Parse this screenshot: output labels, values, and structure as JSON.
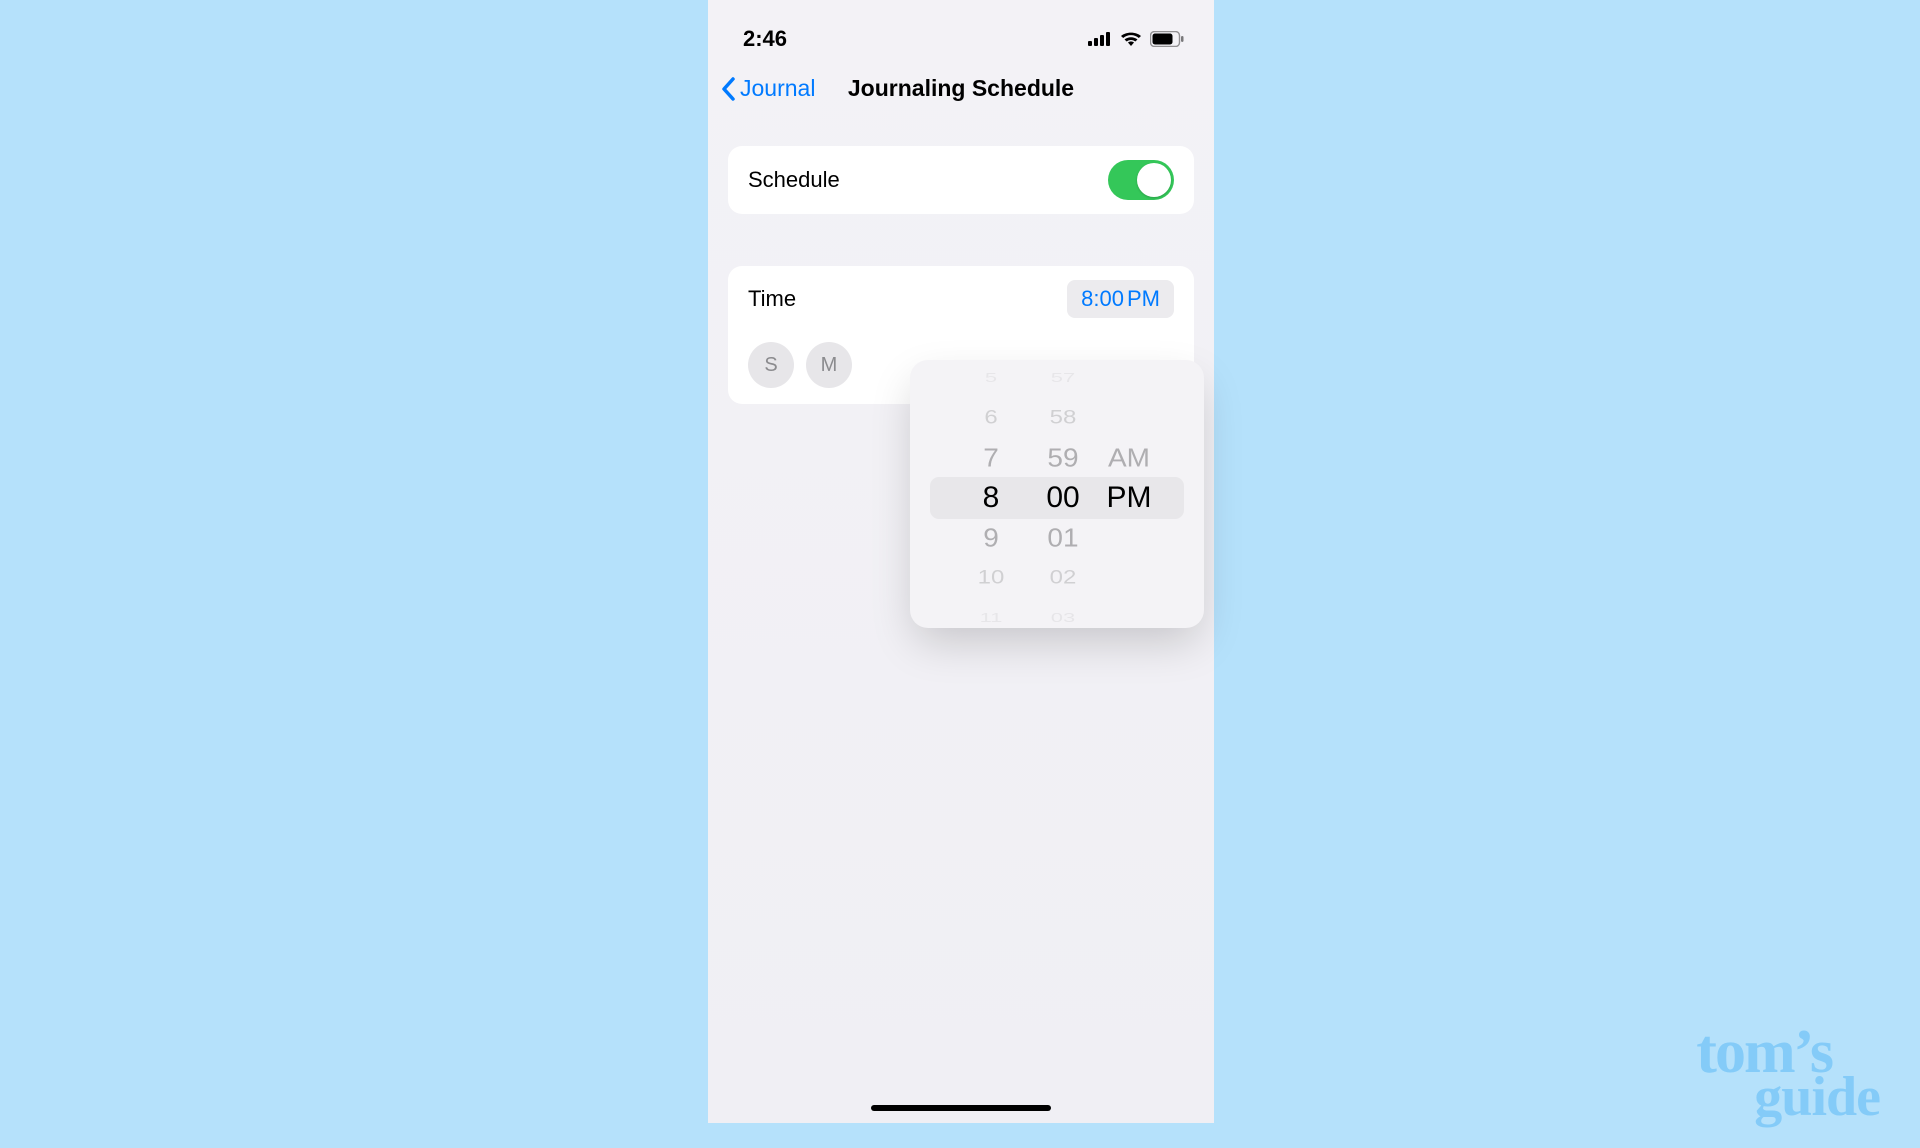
{
  "status": {
    "time": "2:46"
  },
  "nav": {
    "back_label": "Journal",
    "title": "Journaling Schedule"
  },
  "schedule_card": {
    "label": "Schedule",
    "toggle_on": true
  },
  "time_card": {
    "label": "Time",
    "value_hourmin": "8:00",
    "value_period": "PM",
    "days": [
      "S",
      "M"
    ]
  },
  "picker": {
    "hours": [
      "5",
      "6",
      "7",
      "8",
      "9",
      "10",
      "11"
    ],
    "minutes": [
      "57",
      "58",
      "59",
      "00",
      "01",
      "02",
      "03"
    ],
    "periods": [
      "AM",
      "PM"
    ],
    "selected_index": 3,
    "selected_period_index": 1
  },
  "watermark": {
    "line1": "tom’s",
    "line2": "guide"
  }
}
